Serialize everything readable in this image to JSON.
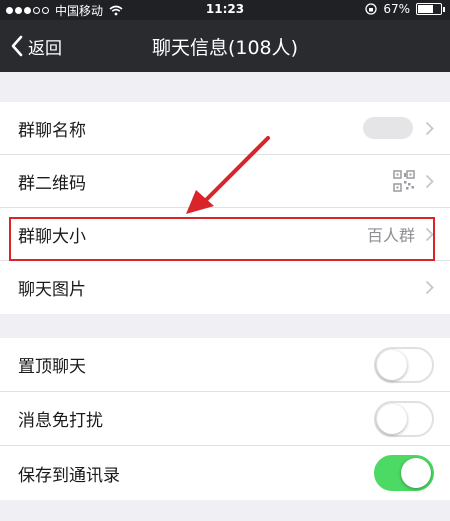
{
  "status_bar": {
    "carrier": "中国移动",
    "time": "11:23",
    "battery": "67%",
    "battery_level": 0.67
  },
  "nav": {
    "back_label": "返回",
    "title": "聊天信息(108人)"
  },
  "group_section": {
    "items": [
      {
        "label": "群聊名称",
        "value": ""
      },
      {
        "label": "群二维码",
        "value": ""
      },
      {
        "label": "群聊大小",
        "value": "百人群"
      },
      {
        "label": "聊天图片",
        "value": ""
      }
    ]
  },
  "settings_section": {
    "items": [
      {
        "label": "置顶聊天",
        "on": false
      },
      {
        "label": "消息免打扰",
        "on": false
      },
      {
        "label": "保存到通讯录",
        "on": true
      }
    ]
  },
  "colors": {
    "nav_bg": "#2a2b2f",
    "toggle_on": "#4cd964",
    "highlight": "#d9242a"
  }
}
